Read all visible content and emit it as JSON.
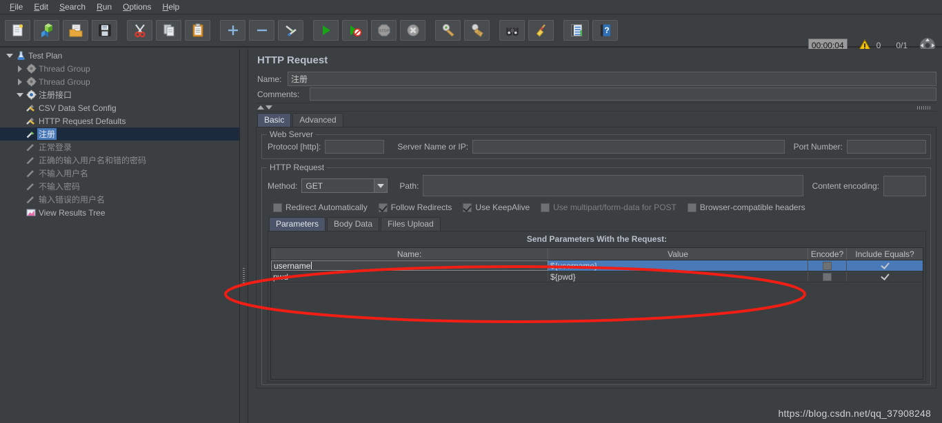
{
  "menu": {
    "items": [
      {
        "label": "File",
        "mnemonic": "F"
      },
      {
        "label": "Edit",
        "mnemonic": "E"
      },
      {
        "label": "Search",
        "mnemonic": "S"
      },
      {
        "label": "Run",
        "mnemonic": "R"
      },
      {
        "label": "Options",
        "mnemonic": "O"
      },
      {
        "label": "Help",
        "mnemonic": "H"
      }
    ]
  },
  "toolbar": {
    "buttons": [
      {
        "icon": "new-file-icon",
        "name": "new-button"
      },
      {
        "icon": "templates-icon",
        "name": "templates-button"
      },
      {
        "icon": "open-folder-icon",
        "name": "open-button"
      },
      {
        "icon": "save-icon",
        "name": "save-button"
      },
      {
        "icon": "cut-scissors-icon",
        "name": "cut-button"
      },
      {
        "icon": "copy-icon",
        "name": "copy-button"
      },
      {
        "icon": "paste-clipboard-icon",
        "name": "paste-button"
      },
      {
        "icon": "plus-icon",
        "name": "expand-button"
      },
      {
        "icon": "minus-icon",
        "name": "collapse-button"
      },
      {
        "icon": "toggle-icon",
        "name": "toggle-button"
      },
      {
        "icon": "run-play-icon",
        "name": "start-button"
      },
      {
        "icon": "run-no-timers-icon",
        "name": "start-no-pauses-button"
      },
      {
        "icon": "stop-icon",
        "name": "stop-button"
      },
      {
        "icon": "shutdown-icon",
        "name": "shutdown-button"
      },
      {
        "icon": "clear-icon",
        "name": "clear-button"
      },
      {
        "icon": "clear-all-icon",
        "name": "clear-all-button"
      },
      {
        "icon": "binoculars-search-icon",
        "name": "search-button"
      },
      {
        "icon": "broom-reset-icon",
        "name": "reset-search-button"
      },
      {
        "icon": "function-helper-icon",
        "name": "function-helper-button"
      },
      {
        "icon": "help-book-icon",
        "name": "help-button"
      }
    ]
  },
  "status": {
    "timer": "00:00:04",
    "warning_icon": "warning-triangle-icon",
    "warning_count": "0",
    "threads": "0/1",
    "expand_icon": "crosshair-expand-icon"
  },
  "tree": {
    "nodes": [
      {
        "label": "Test Plan",
        "indent": 0,
        "toggle": "down",
        "icon": "testplan-icon",
        "state": "normal"
      },
      {
        "label": "Thread Group",
        "indent": 1,
        "toggle": "right",
        "icon": "threadgroup-icon",
        "state": "dim"
      },
      {
        "label": "Thread Group",
        "indent": 1,
        "toggle": "right",
        "icon": "threadgroup-icon",
        "state": "dim"
      },
      {
        "label": "注册接口",
        "indent": 1,
        "toggle": "down",
        "icon": "threadgroup-active-icon",
        "state": "normal"
      },
      {
        "label": "CSV Data Set Config",
        "indent": 2,
        "toggle": "none",
        "icon": "config-element-icon",
        "state": "normal"
      },
      {
        "label": "HTTP Request Defaults",
        "indent": 2,
        "toggle": "none",
        "icon": "config-element-icon",
        "state": "normal"
      },
      {
        "label": "注册",
        "indent": 2,
        "toggle": "none",
        "icon": "sampler-icon",
        "state": "selected"
      },
      {
        "label": "正常登录",
        "indent": 2,
        "toggle": "none",
        "icon": "sampler-disabled-icon",
        "state": "dim"
      },
      {
        "label": "正确的输入用户名和错的密码",
        "indent": 2,
        "toggle": "none",
        "icon": "sampler-disabled-icon",
        "state": "dim"
      },
      {
        "label": "不输入用户名",
        "indent": 2,
        "toggle": "none",
        "icon": "sampler-disabled-icon",
        "state": "dim"
      },
      {
        "label": "不输入密码",
        "indent": 2,
        "toggle": "none",
        "icon": "sampler-disabled-icon",
        "state": "dim"
      },
      {
        "label": "输入错误的用户名",
        "indent": 2,
        "toggle": "none",
        "icon": "sampler-disabled-icon",
        "state": "dim"
      },
      {
        "label": "View Results Tree",
        "indent": 2,
        "toggle": "none",
        "icon": "listener-icon",
        "state": "normal"
      }
    ]
  },
  "panel": {
    "title": "HTTP Request",
    "name_label": "Name:",
    "name_value": "注册",
    "comments_label": "Comments:",
    "comments_value": "",
    "tabs": [
      {
        "label": "Basic",
        "active": true
      },
      {
        "label": "Advanced",
        "active": false
      }
    ],
    "web_server": {
      "group_title": "Web Server",
      "protocol_label": "Protocol [http]:",
      "protocol_value": "",
      "server_label": "Server Name or IP:",
      "server_value": "",
      "port_label": "Port Number:",
      "port_value": ""
    },
    "http_request": {
      "group_title": "HTTP Request",
      "method_label": "Method:",
      "method_value": "GET",
      "path_label": "Path:",
      "path_value": "",
      "content_encoding_label": "Content encoding:",
      "content_encoding_value": "",
      "checkboxes": [
        {
          "label": "Redirect Automatically",
          "checked": false,
          "enabled": true
        },
        {
          "label": "Follow Redirects",
          "checked": true,
          "enabled": true
        },
        {
          "label": "Use KeepAlive",
          "checked": true,
          "enabled": true
        },
        {
          "label": "Use multipart/form-data for POST",
          "checked": false,
          "enabled": false
        },
        {
          "label": "Browser-compatible headers",
          "checked": false,
          "enabled": true
        }
      ]
    },
    "param_tabs": [
      {
        "label": "Parameters",
        "active": true
      },
      {
        "label": "Body Data",
        "active": false
      },
      {
        "label": "Files Upload",
        "active": false
      }
    ],
    "params": {
      "section_label": "Send Parameters With the Request:",
      "columns": [
        "Name:",
        "Value",
        "Encode?",
        "Include Equals?"
      ],
      "rows": [
        {
          "name": "username",
          "value": "${username}",
          "encode": false,
          "include_equals": true,
          "selected": true,
          "editing": true
        },
        {
          "name": "pwd",
          "value": "${pwd}",
          "encode": false,
          "include_equals": true,
          "selected": false,
          "editing": false
        }
      ]
    }
  },
  "annotation": {
    "shape": "red-ellipse-highlight",
    "color": "#f01e14"
  },
  "watermark": "https://blog.csdn.net/qq_37908248"
}
